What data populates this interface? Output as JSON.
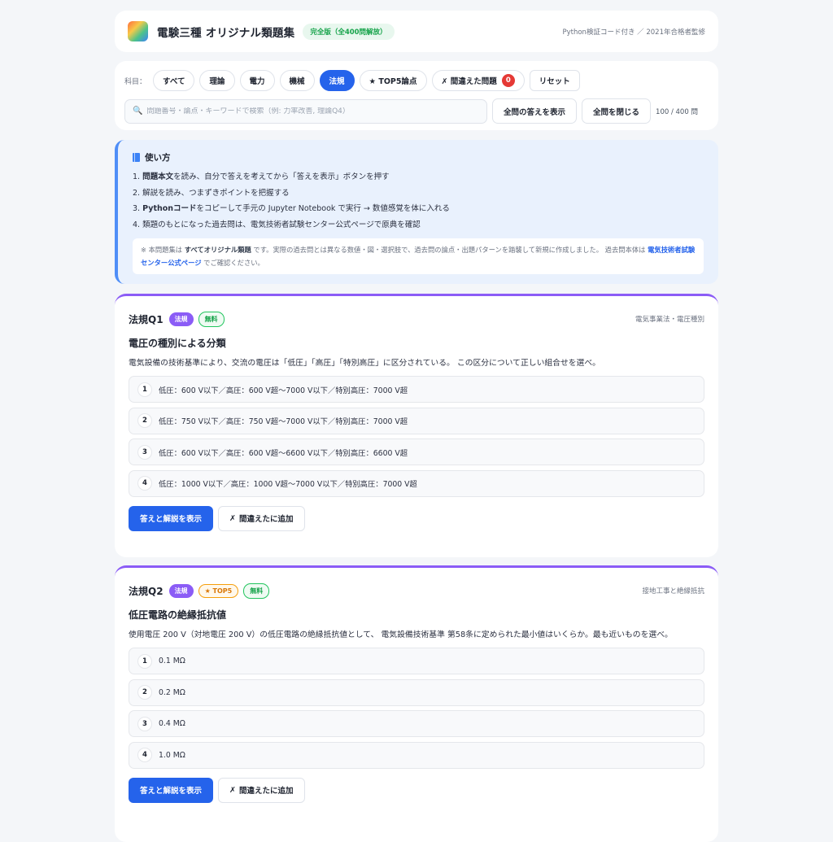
{
  "header": {
    "title": "電験三種 オリジナル類題集",
    "edition_badge": "完全版（全400問解放）",
    "note": "Python検証コード付き ／ 2021年合格者監修"
  },
  "filters": {
    "subject_label": "科目：",
    "chips": [
      "すべて",
      "理論",
      "電力",
      "機械",
      "法規",
      "★ TOP5論点"
    ],
    "active_chip": "法規",
    "mistakes_label": "✗ 間違えた問題",
    "mistakes_count": "0",
    "reset_label": "リセット",
    "search_placeholder": "問題番号・論点・キーワードで検索（例: 力率改善, 理論Q4）",
    "show_all_label": "全問の答えを表示",
    "close_all_label": "全問を閉じる",
    "progress": "100 / 400 問"
  },
  "usage": {
    "title": "使い方",
    "steps": [
      {
        "num": "1.",
        "bold": "問題本文",
        "rest": "を読み、自分で答えを考えてから「答えを表示」ボタンを押す"
      },
      {
        "num": "2.",
        "bold": "",
        "rest": "解説を読み、つまずきポイントを把握する"
      },
      {
        "num": "3.",
        "bold": "Pythonコード",
        "rest": "をコピーして手元の Jupyter Notebook で実行 → 数値感覚を体に入れる"
      },
      {
        "num": "4.",
        "bold": "",
        "rest": "類題のもとになった過去問は、電気技術者試験センター公式ページで原典を確認"
      }
    ],
    "note_prefix": "※ 本問題集は",
    "note_bold": "すべてオリジナル類題",
    "note_mid": "です。実際の過去問とは異なる数値・図・選択肢で、過去問の論点・出題パターンを踏襲して新規に作成しました。 過去問本体は",
    "note_link": "電気技術者試験センター公式ページ",
    "note_suffix": "でご確認ください。"
  },
  "questions": [
    {
      "num": "法規Q1",
      "tag_subject": "法規",
      "tag_free": "無料",
      "topic": "電気事業法・電圧種別",
      "title": "電圧の種別による分類",
      "body": "電気設備の技術基準により、交流の電圧は「低圧」「高圧」「特別高圧」に区分されている。 この区分について正しい組合せを選べ。",
      "choices": [
        "低圧：600 V以下／高圧：600 V超〜7000 V以下／特別高圧：7000 V超",
        "低圧：750 V以下／高圧：750 V超〜7000 V以下／特別高圧：7000 V超",
        "低圧：600 V以下／高圧：600 V超〜6600 V以下／特別高圧：6600 V超",
        "低圧：1000 V以下／高圧：1000 V超〜7000 V以下／特別高圧：7000 V超"
      ],
      "show_label": "答えと解説を表示",
      "add_label": "間違えたに追加"
    },
    {
      "num": "法規Q2",
      "tag_subject": "法規",
      "tag_top5": "★ TOP5",
      "tag_free": "無料",
      "topic": "接地工事と絶縁抵抗",
      "title": "低圧電路の絶縁抵抗値",
      "body": "使用電圧 200 V（対地電圧 200 V）の低圧電路の絶縁抵抗値として、 電気設備技術基準 第58条に定められた最小値はいくらか。最も近いものを選べ。",
      "choices": [
        "0.1 MΩ",
        "0.2 MΩ",
        "0.4 MΩ",
        "1.0 MΩ"
      ],
      "show_label": "答えと解説を表示",
      "add_label": "間違えたに追加"
    }
  ],
  "choice_numbers": [
    "1",
    "2",
    "3",
    "4"
  ],
  "icons": {
    "x": "✗",
    "search": "search-icon",
    "book": "book-icon"
  },
  "colors": {
    "primary": "#2563eb",
    "accent": "#8b5cf6",
    "free": "#16a34a",
    "top5": "#d97706",
    "danger": "#e53935"
  }
}
